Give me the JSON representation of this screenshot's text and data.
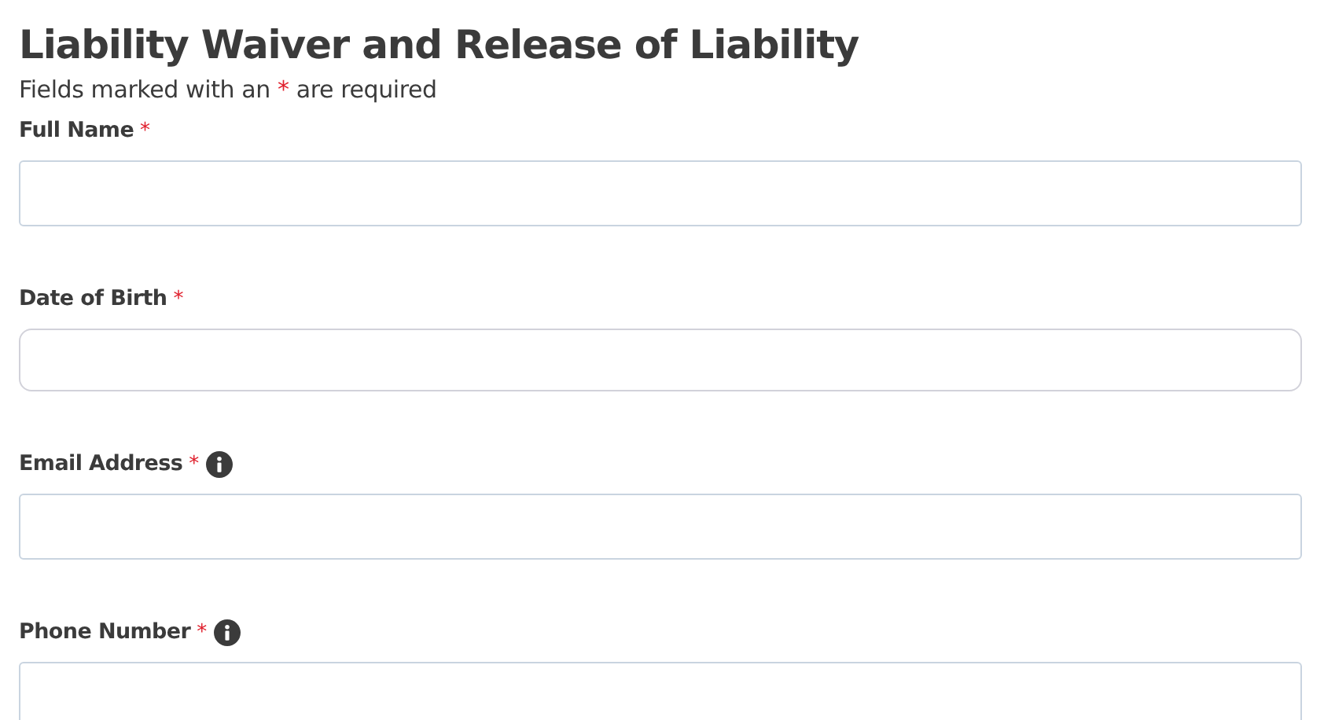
{
  "title": "Liability Waiver and Release of Liability",
  "note": {
    "before": "Fields marked with an",
    "mark": "*",
    "after": "are required"
  },
  "fields": [
    {
      "label": "Full Name",
      "required_mark": "*",
      "info": false,
      "kind": "text"
    },
    {
      "label": "Date of Birth",
      "required_mark": "*",
      "info": false,
      "kind": "date"
    },
    {
      "label": "Email Address",
      "required_mark": "*",
      "info": true,
      "kind": "text"
    },
    {
      "label": "Phone Number",
      "required_mark": "*",
      "info": true,
      "kind": "text"
    }
  ]
}
